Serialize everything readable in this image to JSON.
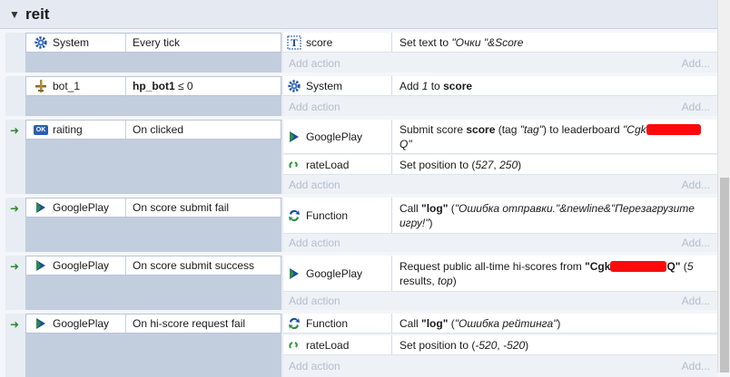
{
  "group": {
    "toggle": "▼",
    "title": "reit"
  },
  "add_action": "Add action",
  "add_more": "Add...",
  "events": [
    {
      "condition": {
        "object": "System",
        "icon": "gear-icon",
        "text": "Every tick"
      },
      "actions": [
        {
          "object": "score",
          "icon": "text-icon",
          "parts": [
            [
              "Set text to ",
              ""
            ],
            [
              "\"Очки \"&Score",
              "i"
            ]
          ]
        }
      ]
    },
    {
      "condition": {
        "object": "bot_1",
        "icon": "plane-icon",
        "text_bold": "hp_bot1",
        "text_rest": " ≤ 0"
      },
      "actions": [
        {
          "object": "System",
          "icon": "gear-icon",
          "parts": [
            [
              "Add ",
              ""
            ],
            [
              "1",
              "i"
            ],
            [
              " to ",
              ""
            ],
            [
              "score",
              "b"
            ]
          ]
        }
      ]
    },
    {
      "condition": {
        "object": "raiting",
        "icon": "ok-button-icon",
        "text": "On clicked"
      },
      "actions": [
        {
          "object": "GooglePlay",
          "icon": "play-icon",
          "parts": [
            [
              "Submit score ",
              ""
            ],
            [
              "score",
              "b"
            ],
            [
              " (tag ",
              ""
            ],
            [
              "\"tag\"",
              "i"
            ],
            [
              ") to leaderboard ",
              ""
            ],
            [
              "\"Cgk",
              "i"
            ],
            [
              "",
              "redact"
            ],
            [
              "Q\"",
              "i"
            ]
          ]
        },
        {
          "object": "rateLoad",
          "icon": "sprite-icon",
          "parts": [
            [
              "Set position to (",
              ""
            ],
            [
              "527",
              "i"
            ],
            [
              ", ",
              ""
            ],
            [
              "250",
              "i"
            ],
            [
              ")",
              ""
            ]
          ]
        }
      ]
    },
    {
      "condition": {
        "object": "GooglePlay",
        "icon": "play-icon",
        "text": "On score submit fail"
      },
      "actions": [
        {
          "object": "Function",
          "icon": "function-icon",
          "parts": [
            [
              "Call ",
              ""
            ],
            [
              "\"log\"",
              "b"
            ],
            [
              " (",
              ""
            ],
            [
              "\"Ошибка отправки.\"&newline&\"Перезагрузите игру!\"",
              "i"
            ],
            [
              ")",
              ""
            ]
          ]
        }
      ]
    },
    {
      "condition": {
        "object": "GooglePlay",
        "icon": "play-icon",
        "text": "On score submit success"
      },
      "actions": [
        {
          "object": "GooglePlay",
          "icon": "play-icon",
          "parts": [
            [
              "Request public all-time hi-scores from ",
              ""
            ],
            [
              "\"Cgk",
              "b"
            ],
            [
              "",
              "redact"
            ],
            [
              "Q\"",
              "b"
            ],
            [
              " (",
              ""
            ],
            [
              "5",
              "i"
            ],
            [
              " results, ",
              ""
            ],
            [
              "top",
              "i"
            ],
            [
              ")",
              ""
            ]
          ]
        }
      ]
    },
    {
      "condition": {
        "object": "GooglePlay",
        "icon": "play-icon",
        "text": "On hi-score request fail"
      },
      "actions": [
        {
          "object": "Function",
          "icon": "function-icon",
          "parts": [
            [
              "Call ",
              ""
            ],
            [
              "\"log\"",
              "b"
            ],
            [
              " (",
              ""
            ],
            [
              "\"Ошибка рейтинга\"",
              "i"
            ],
            [
              ")",
              ""
            ]
          ]
        },
        {
          "object": "rateLoad",
          "icon": "sprite-icon",
          "parts": [
            [
              "Set position to (",
              ""
            ],
            [
              "-520",
              "i"
            ],
            [
              ", ",
              ""
            ],
            [
              "-520",
              "i"
            ],
            [
              ")",
              ""
            ]
          ]
        }
      ]
    }
  ]
}
